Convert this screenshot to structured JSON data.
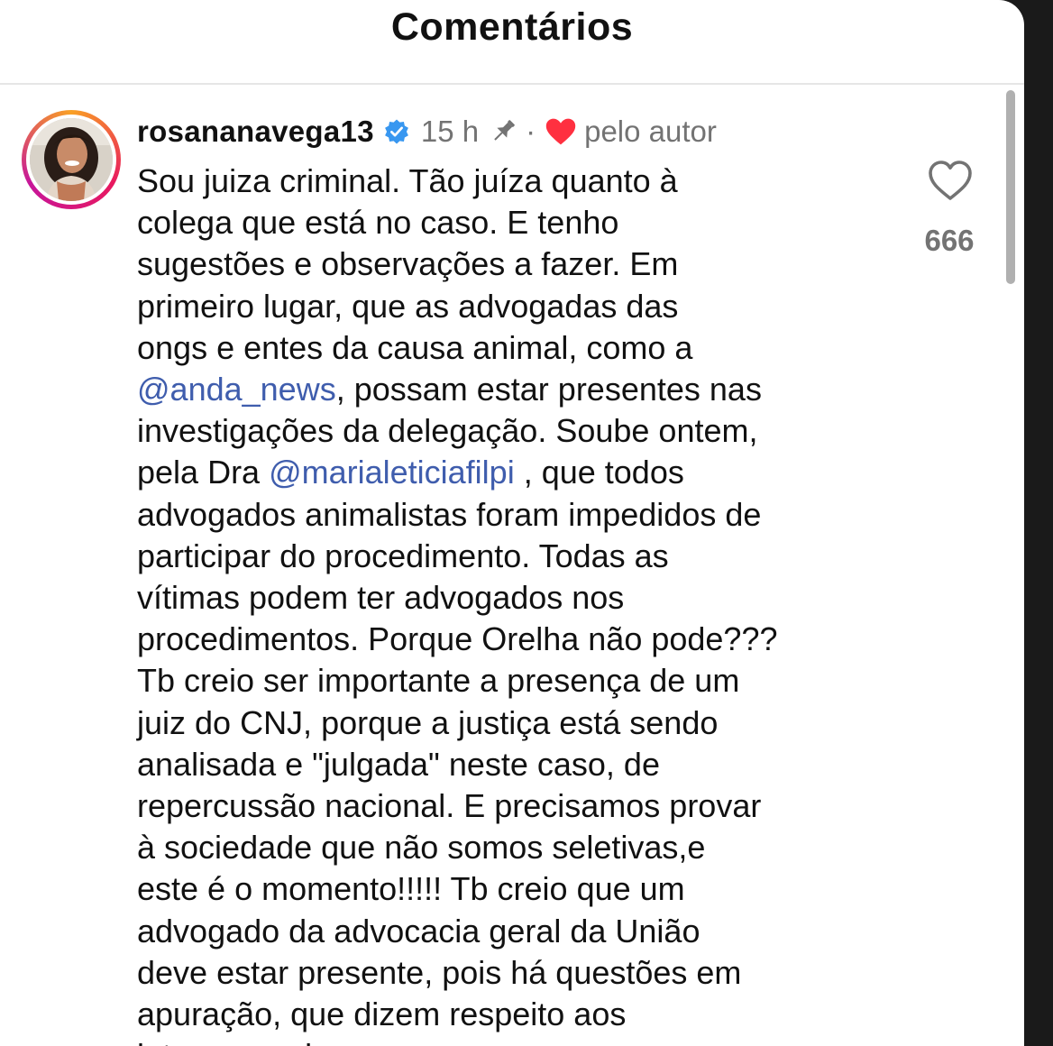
{
  "header": {
    "title": "Comentários"
  },
  "comment": {
    "username": "rosananavega13",
    "time": "15 h",
    "separator": "·",
    "liked_by_author": "pelo autor",
    "like_count": "666",
    "text_part1": "Sou juiza  criminal.  Tão  juíza  quanto  à\ncolega  que está  no caso. E tenho\nsugestões  e observações  a fazer.  Em\nprimeiro  lugar, que  as advogadas  das\nongs e entes da causa animal,  como a\n",
    "mention1": "@anda_news",
    "text_part2": ", possam estar presentes nas\ninvestigações da delegação.  Soube ontem,\npela Dra ",
    "mention2": "@marialeticiafilpi",
    "text_part3": " , que todos\nadvogados animalistas foram impedidos de\nparticipar do procedimento. Todas as\nvítimas podem ter advogados nos\nprocedimentos. Porque Orelha não pode???\nTb creio ser importante a presença de um\njuiz do CNJ, porque a justiça está sendo\nanalisada e \"julgada\" neste caso, de\nrepercussão  nacional.  E precisamos provar\nà sociedade  que não  somos seletivas,e\neste é  o momento!!!!! Tb creio que um\nadvogado da advocacia  geral da União\ndeve estar presente,  pois há  questões  em\napuração,  que dizem respeito  aos\ninteresses da ..."
  },
  "icons": {
    "verified": "verified-badge-icon",
    "pin": "pin-icon",
    "heart": "heart-filled-icon",
    "like": "heart-outline-icon"
  },
  "colors": {
    "mention": "#3f5dad",
    "verified": "#3897f0",
    "heart": "#ff3040",
    "muted": "#737373"
  }
}
